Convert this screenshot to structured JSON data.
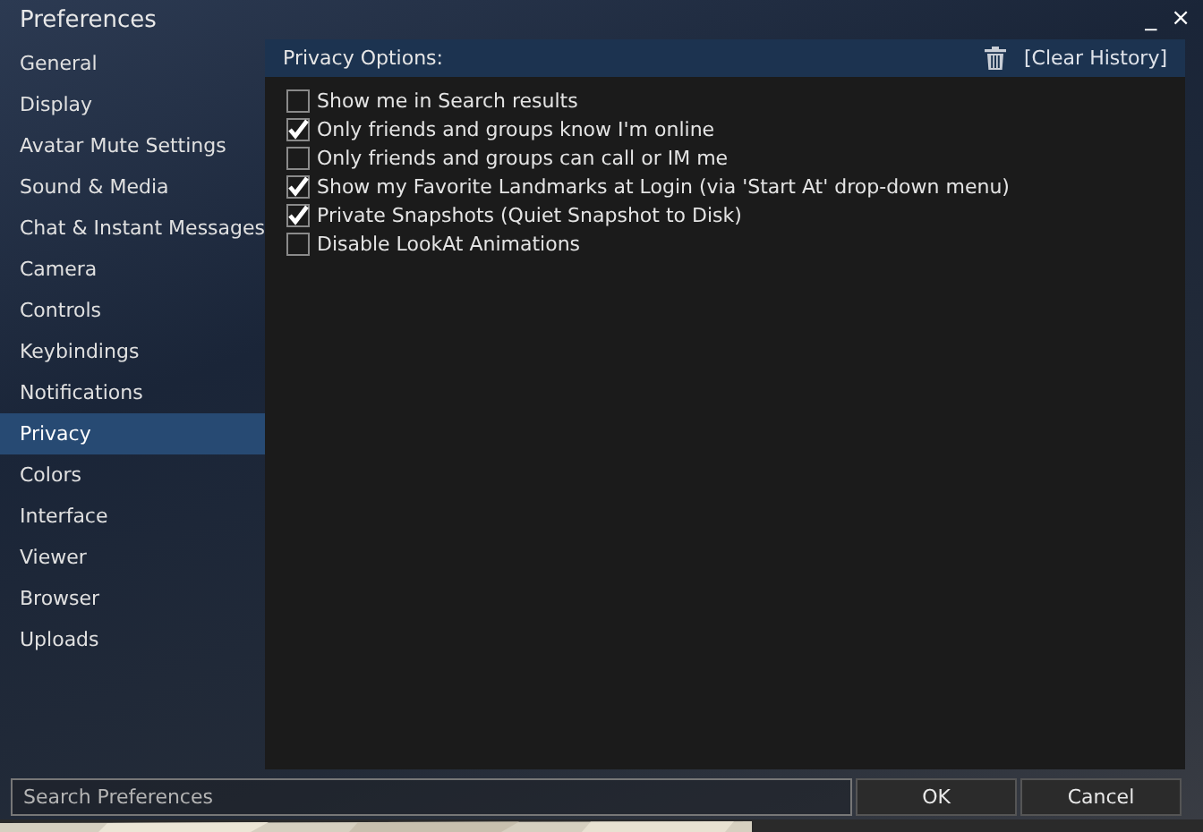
{
  "window": {
    "title": "Preferences",
    "controls": [
      "_",
      "×"
    ]
  },
  "sidebar": {
    "items": [
      {
        "label": "General",
        "selected": false
      },
      {
        "label": "Display",
        "selected": false
      },
      {
        "label": "Avatar Mute Settings",
        "selected": false
      },
      {
        "label": "Sound & Media",
        "selected": false
      },
      {
        "label": "Chat & Instant Messages",
        "selected": false
      },
      {
        "label": "Camera",
        "selected": false
      },
      {
        "label": "Controls",
        "selected": false
      },
      {
        "label": "Keybindings",
        "selected": false
      },
      {
        "label": "Notifications",
        "selected": false
      },
      {
        "label": "Privacy",
        "selected": true
      },
      {
        "label": "Colors",
        "selected": false
      },
      {
        "label": "Interface",
        "selected": false
      },
      {
        "label": "Viewer",
        "selected": false
      },
      {
        "label": "Browser",
        "selected": false
      },
      {
        "label": "Uploads",
        "selected": false
      }
    ]
  },
  "panel": {
    "title": "Privacy Options:",
    "clear_history": "[Clear History]",
    "options": [
      {
        "label": "Show me in Search results",
        "checked": false
      },
      {
        "label": "Only friends and groups know I'm online",
        "checked": true
      },
      {
        "label": "Only friends and groups can call or IM me",
        "checked": false
      },
      {
        "label": "Show my Favorite Landmarks at Login (via 'Start At' drop-down menu)",
        "checked": true
      },
      {
        "label": "Private Snapshots (Quiet Snapshot to Disk)",
        "checked": true
      },
      {
        "label": "Disable LookAt Animations",
        "checked": false
      }
    ]
  },
  "search": {
    "placeholder": "Search Preferences"
  },
  "buttons": [
    "OK",
    "Cancel"
  ]
}
